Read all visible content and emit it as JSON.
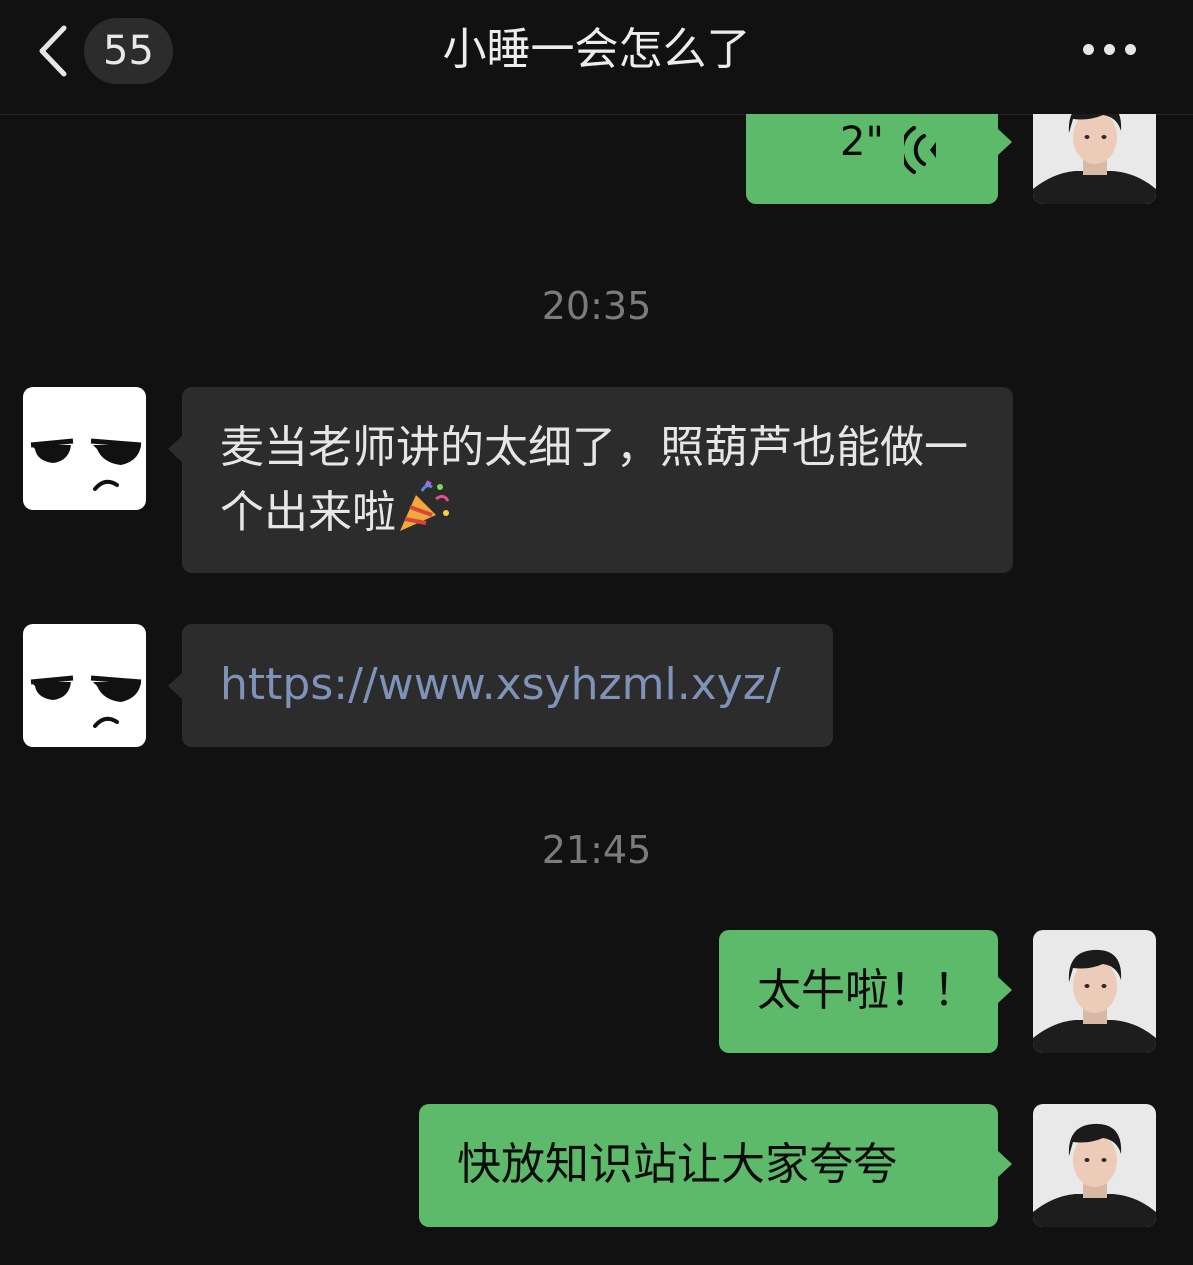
{
  "nav": {
    "unread_count": "55",
    "title": "小睡一会怎么了"
  },
  "messages": [
    {
      "type": "voice",
      "side": "me",
      "duration": "2\""
    },
    {
      "type": "timestamp",
      "text": "20:35"
    },
    {
      "type": "text",
      "side": "other",
      "text": "麦当老师讲的太细了，照葫芦也能做一个出来啦",
      "emoji": "party-popper"
    },
    {
      "type": "link",
      "side": "other",
      "text": "https://www.xsyhzml.xyz/"
    },
    {
      "type": "timestamp",
      "text": "21:45"
    },
    {
      "type": "text",
      "side": "me",
      "text": "太牛啦！！"
    },
    {
      "type": "text",
      "side": "me",
      "text": "快放知识站让大家夸夸"
    }
  ],
  "colors": {
    "background": "#111111",
    "my_bubble": "#5dba6a",
    "other_bubble": "#2c2c2c",
    "link": "#7f92b8",
    "timestamp": "#7b7b7b"
  },
  "icons": {
    "back": "chevron-left-icon",
    "more": "more-dots-icon",
    "voice": "voice-wave-icon",
    "emoji": "party-popper-icon"
  }
}
